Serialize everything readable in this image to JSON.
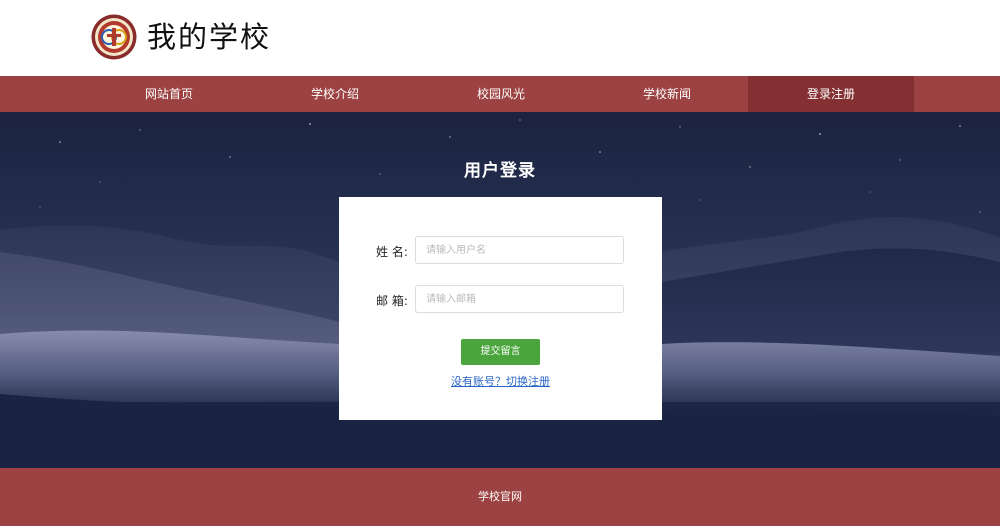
{
  "header": {
    "logo_icon": "school-emblem-icon",
    "site_title": "我的学校"
  },
  "nav": {
    "items": [
      {
        "label": "网站首页",
        "active": false
      },
      {
        "label": "学校介绍",
        "active": false
      },
      {
        "label": "校园风光",
        "active": false
      },
      {
        "label": "学校新闻",
        "active": false
      },
      {
        "label": "登录注册",
        "active": true
      }
    ]
  },
  "login": {
    "title": "用户登录",
    "name_label": "姓 名:",
    "name_placeholder": "请输入用户名",
    "name_value": "",
    "email_label": "邮 箱:",
    "email_placeholder": "请输入邮箱",
    "email_value": "",
    "submit_label": "提交留言",
    "switch_link": "没有账号？切换注册"
  },
  "footer": {
    "text": "学校官网"
  },
  "colors": {
    "brand_red": "#9c4242",
    "nav_active": "#842f31",
    "submit_green": "#4aa53c",
    "link_blue": "#2a66c4"
  }
}
